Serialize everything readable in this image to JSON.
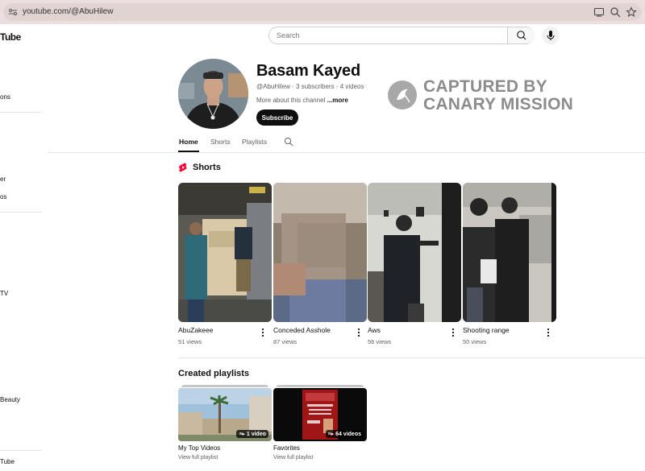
{
  "browser": {
    "url": "youtube.com/@AbuHilew"
  },
  "header": {
    "logo_text": "Tube",
    "search_placeholder": "Search"
  },
  "sidebar": {
    "fragments": [
      "ons",
      "er",
      "os",
      "TV",
      "Beauty",
      "Tube"
    ]
  },
  "channel": {
    "name": "Basam Kayed",
    "meta": "@AbuHilew · 3 subscribers · 4 videos",
    "about_prefix": "More about this channel ",
    "about_more": "...more",
    "subscribe_label": "Subscribe"
  },
  "watermark": {
    "line1": "CAPTURED BY",
    "line2": "CANARY MISSION"
  },
  "tabs": [
    {
      "label": "Home",
      "active": true
    },
    {
      "label": "Shorts",
      "active": false
    },
    {
      "label": "Playlists",
      "active": false
    }
  ],
  "shorts": {
    "title": "Shorts",
    "items": [
      {
        "title": "AbuZakeee",
        "views": "51 views"
      },
      {
        "title": "Conceded Asshole",
        "views": "87 views"
      },
      {
        "title": "Aws",
        "views": "56 views"
      },
      {
        "title": "Shooting range",
        "views": "50 views"
      }
    ]
  },
  "playlists": {
    "title": "Created playlists",
    "items": [
      {
        "title": "My Top Videos",
        "count": "1 video",
        "link": "View full playlist"
      },
      {
        "title": "Favorites",
        "count": "64 videos",
        "link": "View full playlist"
      }
    ]
  },
  "colors": {
    "accent": "#ff0033",
    "text": "#0f0f0f",
    "muted": "#606060"
  }
}
